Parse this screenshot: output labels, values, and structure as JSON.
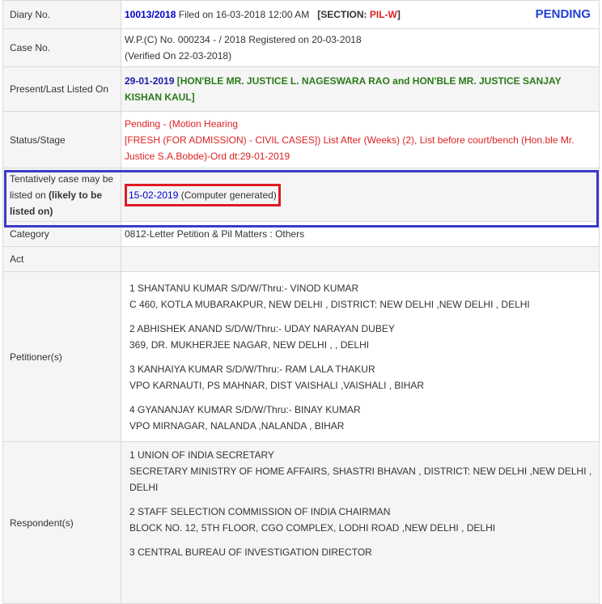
{
  "rows": {
    "diary": {
      "label": "Diary No.",
      "number": "10013/2018",
      "filed": " Filed on 16-03-2018 12:00 AM",
      "section_prefix": "[SECTION: ",
      "section_value": "PIL-W",
      "section_suffix": "]",
      "status_badge": "PENDING"
    },
    "case": {
      "label": "Case No.",
      "line1": "W.P.(C) No. 000234 - / 2018  Registered on 20-03-2018",
      "line2": "(Verified On 22-03-2018)"
    },
    "listed": {
      "label": "Present/Last Listed On",
      "date": "29-01-2019",
      "bench": " [HON'BLE MR. JUSTICE L. NAGESWARA RAO and HON'BLE MR. JUSTICE SANJAY KISHAN KAUL]"
    },
    "status": {
      "label": "Status/Stage",
      "line1": "Pending - (Motion Hearing",
      "line2": "[FRESH (FOR ADMISSION) - CIVIL CASES]) List After (Weeks) (2), List before court/bench (Hon.ble Mr. Justice S.A.Bobde)-Ord dt:29-01-2019"
    },
    "tentative": {
      "label_plain": "Tentatively case may be listed on ",
      "label_bold": "(likely to be listed on)",
      "date": "15-02-2019",
      "note": " (Computer generated)"
    },
    "category": {
      "label": "Category",
      "value": "0812-Letter Petition & Pil Matters : Others"
    },
    "act": {
      "label": "Act",
      "value": ""
    },
    "petitioners": {
      "label": "Petitioner(s)",
      "items": [
        {
          "line1": "1 SHANTANU KUMAR S/D/W/Thru:- VINOD KUMAR",
          "line2": "C 460, KOTLA MUBARAKPUR, NEW DELHI , DISTRICT: NEW DELHI ,NEW DELHI , DELHI"
        },
        {
          "line1": "2 ABHISHEK ANAND S/D/W/Thru:- UDAY NARAYAN DUBEY",
          "line2": "369, DR. MUKHERJEE NAGAR, NEW DELHI , , DELHI"
        },
        {
          "line1": "3 KANHAIYA KUMAR S/D/W/Thru:- RAM LALA THAKUR",
          "line2": "VPO KARNAUTI, PS MAHNAR, DIST VAISHALI ,VAISHALI , BIHAR"
        },
        {
          "line1": "4 GYANANJAY KUMAR S/D/W/Thru:- BINAY KUMAR",
          "line2": "VPO MIRNAGAR, NALANDA ,NALANDA , BIHAR"
        }
      ]
    },
    "respondents": {
      "label": "Respondent(s)",
      "items": [
        {
          "line1": "1 UNION OF INDIA SECRETARY",
          "line2": "SECRETARY MINISTRY OF HOME AFFAIRS, SHASTRI BHAVAN , DISTRICT: NEW DELHI ,NEW DELHI , DELHI"
        },
        {
          "line1": "2 STAFF SELECTION COMMISSION OF INDIA CHAIRMAN",
          "line2": "BLOCK NO. 12, 5TH FLOOR, CGO COMPLEX, LODHI ROAD ,NEW DELHI , DELHI"
        },
        {
          "line1": "3 CENTRAL BUREAU OF INVESTIGATION DIRECTOR",
          "line2": ""
        }
      ]
    }
  },
  "colors": {
    "highlight_row_border": "#3a3acb",
    "highlight_date_border": "#e01b24",
    "pending": "#1f3fd4",
    "bench": "#2a7a1a",
    "status_text": "#dd2222"
  }
}
